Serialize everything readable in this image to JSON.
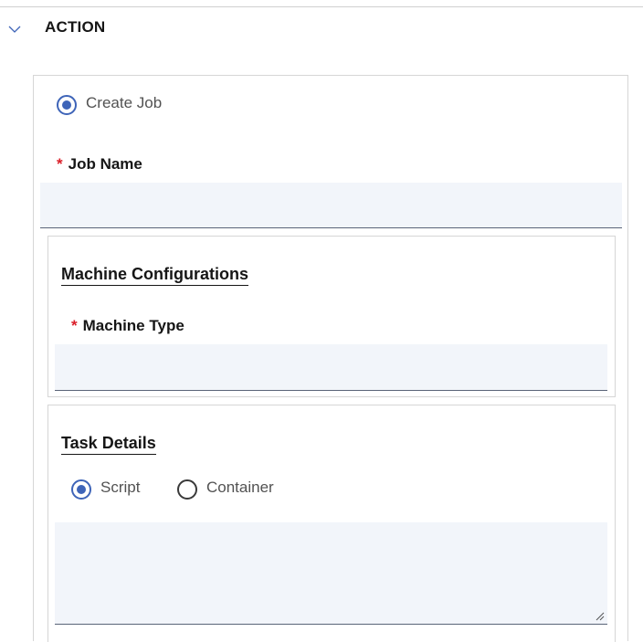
{
  "section": {
    "title": "ACTION",
    "expanded": true,
    "toggle_icon": "chevron-down-icon"
  },
  "action_option": {
    "label": "Create Job",
    "selected": true
  },
  "job_name": {
    "label": "Job Name",
    "required_mark": "*",
    "value": "",
    "placeholder": ""
  },
  "machine_config": {
    "title": "Machine Configurations",
    "machine_type": {
      "label": "Machine Type",
      "required_mark": "*",
      "value": "",
      "placeholder": ""
    }
  },
  "task_details": {
    "title": "Task Details",
    "options": [
      {
        "label": "Script",
        "selected": true
      },
      {
        "label": "Container",
        "selected": false
      }
    ],
    "script_value": "",
    "resize_icon": "resize-grip-icon"
  },
  "colors": {
    "accent": "#3e64b8",
    "required": "#da1e28",
    "field_bg": "#f2f5fa",
    "border": "#d6d6d6"
  }
}
